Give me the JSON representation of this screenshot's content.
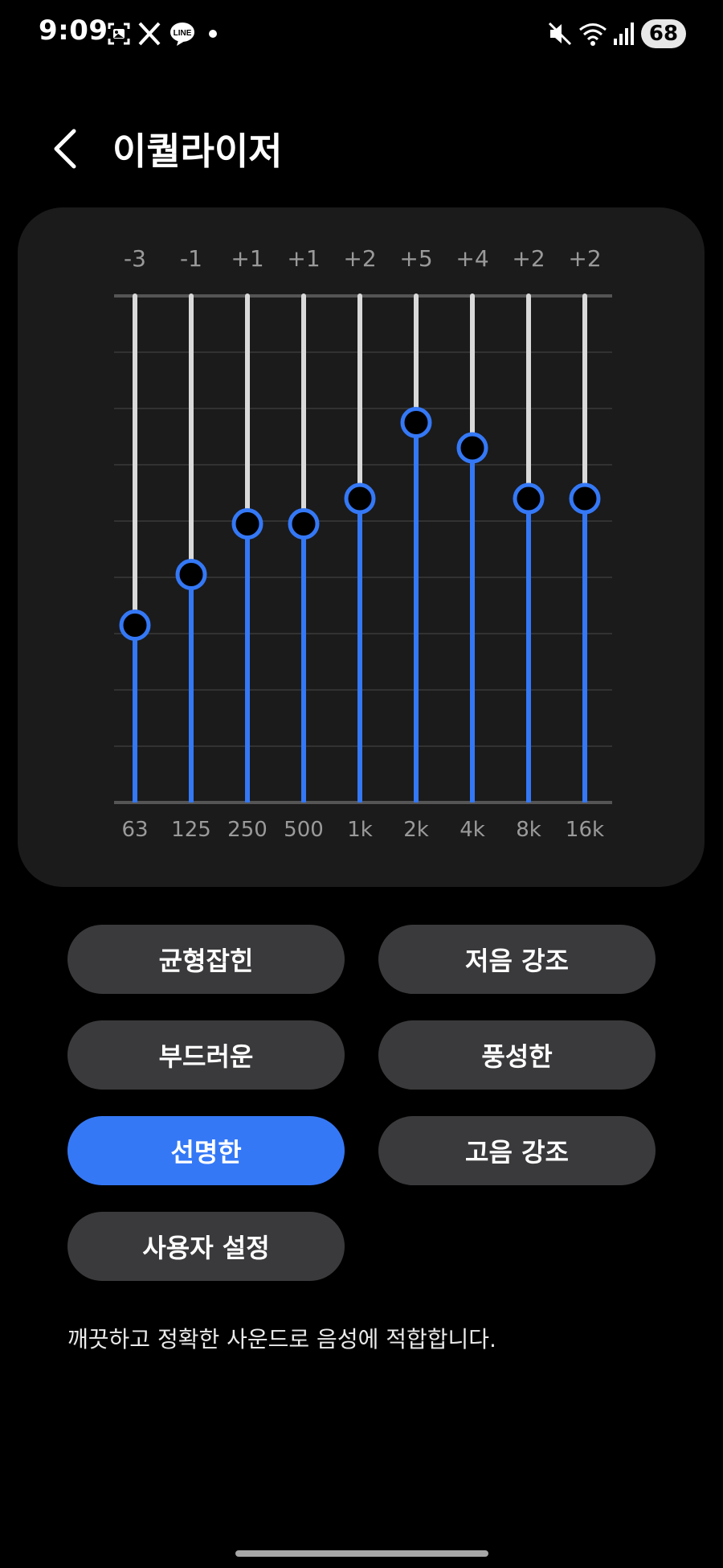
{
  "status_bar": {
    "time": "9:09",
    "battery": "68",
    "icons": [
      "gallery-icon",
      "x-icon",
      "line-icon",
      "dot-icon",
      "mute-icon",
      "wifi-icon",
      "signal-icon"
    ]
  },
  "header": {
    "title": "이퀄라이저",
    "back_icon": "chevron-left-icon"
  },
  "equalizer": {
    "bands": [
      {
        "freq": "63",
        "gain_label": "-3",
        "gain": -3
      },
      {
        "freq": "125",
        "gain_label": "-1",
        "gain": -1
      },
      {
        "freq": "250",
        "gain_label": "+1",
        "gain": 1
      },
      {
        "freq": "500",
        "gain_label": "+1",
        "gain": 1
      },
      {
        "freq": "1k",
        "gain_label": "+2",
        "gain": 2
      },
      {
        "freq": "2k",
        "gain_label": "+5",
        "gain": 5
      },
      {
        "freq": "4k",
        "gain_label": "+4",
        "gain": 4
      },
      {
        "freq": "8k",
        "gain_label": "+2",
        "gain": 2
      },
      {
        "freq": "16k",
        "gain_label": "+2",
        "gain": 2
      }
    ],
    "range": [
      -10,
      10
    ],
    "colors": {
      "active": "#3478f6",
      "track": "#d9d9d9",
      "grid": "#3a3a3a",
      "knob": "#000000"
    }
  },
  "presets": [
    {
      "label": "균형잡힌",
      "active": false
    },
    {
      "label": "저음 강조",
      "active": false
    },
    {
      "label": "부드러운",
      "active": false
    },
    {
      "label": "풍성한",
      "active": false
    },
    {
      "label": "선명한",
      "active": true
    },
    {
      "label": "고음 강조",
      "active": false
    },
    {
      "label": "사용자 설정",
      "active": false
    }
  ],
  "description": "깨끗하고 정확한 사운드로 음성에 적합합니다."
}
